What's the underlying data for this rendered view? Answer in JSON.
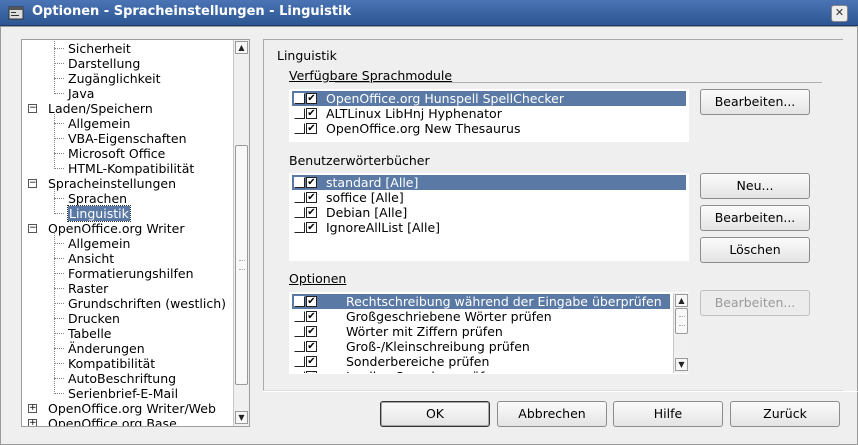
{
  "window": {
    "title": "Optionen - Spracheinstellungen - Linguistik",
    "close_glyph": "✕"
  },
  "tree": {
    "items": [
      {
        "label": "Sicherheit",
        "level": 2
      },
      {
        "label": "Darstellung",
        "level": 2
      },
      {
        "label": "Zugänglichkeit",
        "level": 2
      },
      {
        "label": "Java",
        "level": 2
      },
      {
        "label": "Laden/Speichern",
        "level": 1,
        "expander": "−"
      },
      {
        "label": "Allgemein",
        "level": 2
      },
      {
        "label": "VBA-Eigenschaften",
        "level": 2
      },
      {
        "label": "Microsoft Office",
        "level": 2
      },
      {
        "label": "HTML-Kompatibilität",
        "level": 2
      },
      {
        "label": "Spracheinstellungen",
        "level": 1,
        "expander": "−"
      },
      {
        "label": "Sprachen",
        "level": 2
      },
      {
        "label": "Linguistik",
        "level": 2,
        "selected": true
      },
      {
        "label": "OpenOffice.org Writer",
        "level": 1,
        "expander": "−"
      },
      {
        "label": "Allgemein",
        "level": 2
      },
      {
        "label": "Ansicht",
        "level": 2
      },
      {
        "label": "Formatierungshilfen",
        "level": 2
      },
      {
        "label": "Raster",
        "level": 2
      },
      {
        "label": "Grundschriften (westlich)",
        "level": 2
      },
      {
        "label": "Drucken",
        "level": 2
      },
      {
        "label": "Tabelle",
        "level": 2
      },
      {
        "label": "Änderungen",
        "level": 2
      },
      {
        "label": "Kompatibilität",
        "level": 2
      },
      {
        "label": "AutoBeschriftung",
        "level": 2
      },
      {
        "label": "Serienbrief-E-Mail",
        "level": 2
      },
      {
        "label": "OpenOffice.org Writer/Web",
        "level": 1,
        "expander": "+"
      },
      {
        "label": "OpenOffice.org Base",
        "level": 1,
        "expander": "+"
      }
    ]
  },
  "linguistik": {
    "frame_title": "Linguistik",
    "modules": {
      "label": "Verfügbare Sprachmodule",
      "items": [
        {
          "text": "OpenOffice.org Hunspell SpellChecker",
          "selected": true
        },
        {
          "text": "ALTLinux LibHnj Hyphenator"
        },
        {
          "text": "OpenOffice.org New Thesaurus"
        }
      ],
      "edit_button": "Bearbeiten..."
    },
    "dictionaries": {
      "label": "Benutzerwörterbücher",
      "items": [
        {
          "text": "standard [Alle]",
          "selected": true
        },
        {
          "text": "soffice [Alle]"
        },
        {
          "text": "Debian [Alle]"
        },
        {
          "text": "IgnoreAllList [Alle]"
        }
      ],
      "new_button": "Neu...",
      "edit_button": "Bearbeiten...",
      "delete_button": "Löschen"
    },
    "options": {
      "label": "Optionen",
      "items": [
        {
          "text": "Rechtschreibung während der Eingabe überprüfen",
          "selected": true
        },
        {
          "text": "Großgeschriebene Wörter prüfen"
        },
        {
          "text": "Wörter mit Ziffern prüfen"
        },
        {
          "text": "Groß-/Kleinschreibung prüfen"
        },
        {
          "text": "Sonderbereiche prüfen"
        },
        {
          "text": "In allen Sprachen prüfen"
        }
      ],
      "edit_button": "Bearbeiten..."
    }
  },
  "footer": {
    "ok": "OK",
    "cancel": "Abbrechen",
    "help": "Hilfe",
    "back": "Zurück"
  },
  "check_glyph": "✔"
}
